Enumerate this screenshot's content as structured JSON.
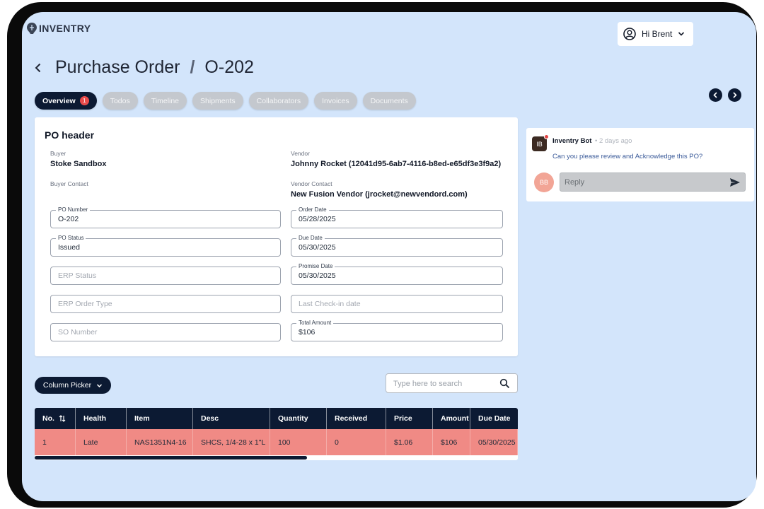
{
  "app": {
    "name": "INVENTRY"
  },
  "user": {
    "greeting": "Hi Brent"
  },
  "title": {
    "section": "Purchase Order",
    "separator": "/",
    "record": "O-202"
  },
  "tabs": [
    {
      "label": "Overview",
      "badge": "1",
      "active": true
    },
    {
      "label": "Todos"
    },
    {
      "label": "Timeline"
    },
    {
      "label": "Shipments"
    },
    {
      "label": "Collaborators"
    },
    {
      "label": "Invoices"
    },
    {
      "label": "Documents"
    }
  ],
  "po_header": {
    "title": "PO header",
    "buyer_label": "Buyer",
    "buyer": "Stoke Sandbox",
    "vendor_label": "Vendor",
    "vendor": "Johnny Rocket (12041d95-6ab7-4116-b8ed-e65df3e3f9a2)",
    "buyer_contact_label": "Buyer Contact",
    "vendor_contact_label": "Vendor Contact",
    "vendor_contact": "New Fusion Vendor (jrocket@newvendord.com)",
    "fields": {
      "po_number": {
        "label": "PO Number",
        "value": "O-202"
      },
      "order_date": {
        "label": "Order Date",
        "value": "05/28/2025"
      },
      "po_status": {
        "label": "PO Status",
        "value": "Issued"
      },
      "due_date": {
        "label": "Due Date",
        "value": "05/30/2025"
      },
      "erp_status": {
        "placeholder": "ERP Status"
      },
      "promise_date": {
        "label": "Promise Date",
        "value": "05/30/2025"
      },
      "erp_order_type": {
        "placeholder": "ERP Order Type"
      },
      "last_checkin": {
        "placeholder": "Last Check-in date"
      },
      "so_number": {
        "placeholder": "SO Number"
      },
      "total_amount": {
        "label": "Total Amount",
        "value": "$106"
      }
    }
  },
  "chat": {
    "bot_initials": "IB",
    "bot_name": "Inventry Bot",
    "time": "• 2 days ago",
    "message": "Can you please review and Acknowledge this PO?",
    "user_initials": "BB",
    "reply_placeholder": "Reply"
  },
  "table_controls": {
    "column_picker": "Column Picker",
    "search_placeholder": "Type here to search"
  },
  "table": {
    "headers": [
      "No.",
      "Health",
      "Item",
      "Desc",
      "Quantity",
      "Received",
      "Price",
      "Amount",
      "Due Date"
    ],
    "rows": [
      [
        "1",
        "Late",
        "NAS1351N4-16",
        "SHCS, 1/4-28 x 1\"L",
        "100",
        "0",
        "$1.06",
        "$106",
        "05/30/2025"
      ]
    ],
    "row_highlight_color": "#f08a85",
    "header_color": "#0c1a33"
  },
  "colors": {
    "accent": "#0c1a33",
    "background": "#d3e5fb",
    "badge": "#e84a4a"
  }
}
